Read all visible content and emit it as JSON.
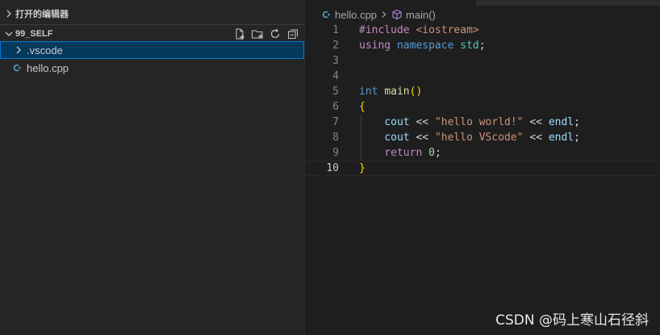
{
  "explorer": {
    "open_editors_label": "打开的编辑器",
    "project_label": "99_SELF",
    "actions": [
      "new-file-icon",
      "new-folder-icon",
      "refresh-icon",
      "collapse-all-icon"
    ],
    "items": [
      {
        "label": ".vscode",
        "type": "folder",
        "selected": true
      },
      {
        "label": "hello.cpp",
        "type": "cpp-file",
        "selected": false
      }
    ]
  },
  "editor": {
    "breadcrumb": {
      "file": "hello.cpp",
      "symbol": "main()"
    },
    "active_line": 10,
    "lines": [
      {
        "n": "1"
      },
      {
        "n": "2"
      },
      {
        "n": "3"
      },
      {
        "n": "4"
      },
      {
        "n": "5"
      },
      {
        "n": "6"
      },
      {
        "n": "7"
      },
      {
        "n": "8"
      },
      {
        "n": "9"
      },
      {
        "n": "10"
      }
    ],
    "code": {
      "l1_directive": "#include",
      "l1_header": "<iostream>",
      "l2_using": "using",
      "l2_namespace": "namespace",
      "l2_std": "std",
      "l2_semi": ";",
      "l5_int": "int",
      "l5_main": "main",
      "l5_parens": "()",
      "l6_open": "{",
      "l7_cout": "cout",
      "l7_op1": " << ",
      "l7_str": "\"hello world!\"",
      "l7_op2": " << ",
      "l7_endl": "endl",
      "l7_semi": ";",
      "l8_cout": "cout",
      "l8_op1": " << ",
      "l8_str": "\"hello VScode\"",
      "l8_op2": " << ",
      "l8_endl": "endl",
      "l8_semi": ";",
      "l9_return": "return",
      "l9_zero": "0",
      "l9_semi": ";",
      "l10_close": "}"
    }
  },
  "watermark": "CSDN @码上寒山石径斜",
  "colors": {
    "selection_bg": "#04395e",
    "selection_border": "#0078d4",
    "cpp_icon": "#519aba"
  }
}
